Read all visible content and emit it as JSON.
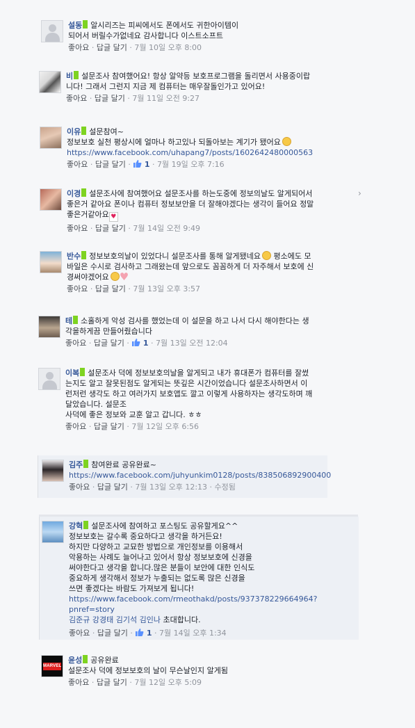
{
  "ui": {
    "like_action": "좋아요",
    "reply_action": "답글 달기",
    "sep": " · ",
    "likes_count": "1",
    "edited": "수정됨",
    "colors": {
      "name": "#365899",
      "meta": "#90949c",
      "highlight": "#7ed321",
      "background": "#f6f7f9"
    }
  },
  "comments": [
    {
      "name": "설동",
      "text_lines": [
        "알시리즈는 피씨에서도 폰에서도 귀한아이템이",
        "되어서 버릴수가없네요 감사합니다 이스트소프트"
      ],
      "time": "7월 10일 오후 8:00",
      "avatar_icon": "default-profile-icon"
    },
    {
      "name": "비",
      "text_lines": [
        "설문조사 참여했어요! 항상 알약등 보호프로그램을 돌리면서 사용중이랍",
        "니다! 그래서 그런지 지금 제 컴퓨터는 매우잘돌인가고 있어요!"
      ],
      "time": "7월 11일 오전 9:27"
    },
    {
      "name": "이유",
      "text_lines": [
        "설문참여~",
        "정보보호 실천 평상시에 얼마나 하고있나 되돌아보는 계기가 됐어요"
      ],
      "link": "https://www.facebook.com/uhapang7/posts/1602642480000563",
      "likes": "1",
      "time": "7월 19일 오후 7:16"
    },
    {
      "name": "이경",
      "text_lines": [
        "설문조사에 참여했어요 설문조사를 하는도중에 정보의날도 알게되어서",
        "좋은거 같아요 폰이나 컴퓨터 정보보안을 더 잘해야겠다는 생각이 들어요 정말",
        "좋은거같아요"
      ],
      "time": "7월 14일 오전 9:49"
    },
    {
      "name": "반수",
      "text_lines": [
        "정보보호의날이 있었다니 설문조사를 통해 알게됐네요",
        "평소에도 모",
        "바일은 수시로 검사하고 그래왔는데 앞으로도 꼼꼼하게 더 자주해서 보호에 신",
        "경써야겠어요"
      ],
      "time": "7월 13일 오후 3:57"
    },
    {
      "name": "테",
      "text_lines": [
        "소홀하게 악성 검사를 했었는데 이 설문을 하고 나서 다시 해야한다는 생",
        "각을하게끔 만들어줬습니다"
      ],
      "likes": "1",
      "time": "7월 13일 오전 12:04"
    },
    {
      "name": "이복",
      "text_lines": [
        "설문조사 덕에 정보보호의날을 알게되고 내가 휴대폰가 컴퓨터를 잘썼",
        "는지도 알고 잘못된점도 알게되는 뜻깊은 시간이었습니다 설문조사하면서 이",
        "런저런 생각도 하고 여러가지 보호앱도 깔고 이렇게 사용하자는 생각도하며 깨",
        "달았습니다. 설문조",
        "사덕에 좋은 정보와 교훈 알고 갑니다. ㅎㅎ"
      ],
      "time": "7월 12일 오후 6:56",
      "avatar_icon": "default-profile-icon"
    },
    {
      "name": "김주",
      "text_lines": [
        "참여완료 공유완료~"
      ],
      "link": "https://www.facebook.com/juhyunkim0128/posts/838506892900400",
      "time": "7월 13일 오후 12:13",
      "edited": true
    },
    {
      "name": "강혁",
      "text_lines": [
        "설문조사에 참여하고 포스팅도 공유할게요^^",
        "정보보호는 갈수록 중요하다고 생각을 하거든요!",
        "하지만 다양하고 교묘한 방법으로 개인정보를 이용해서",
        "악용하는 사례도 늘어나고 있어서 항상 정보보호에 신경을",
        "써야한다고 생각을 합니다.많은 분들이 보안에 대한 인식도",
        "중요하게 생각해서 정보가 누출되는 없도록 많은 신경을",
        "쓰면 좋겠다는 바람도 가져보게 됩니다!"
      ],
      "link": "https://www.facebook.com/rmeothakd/posts/937378229664964?pnref=story",
      "tags": [
        "김준규",
        "강경태",
        "김기석",
        "김인나"
      ],
      "tag_suffix": "초대합니다.",
      "likes": "1",
      "time": "7월 14일 오후 1:34"
    },
    {
      "name": "윤성",
      "text_lines": [
        "공유완료",
        "설문조사 덕에 정보보호의 날이 무슨날인지 알게됨"
      ],
      "time": "7월 12일 오후 5:09",
      "avatar_logo": "MARVEL"
    }
  ]
}
